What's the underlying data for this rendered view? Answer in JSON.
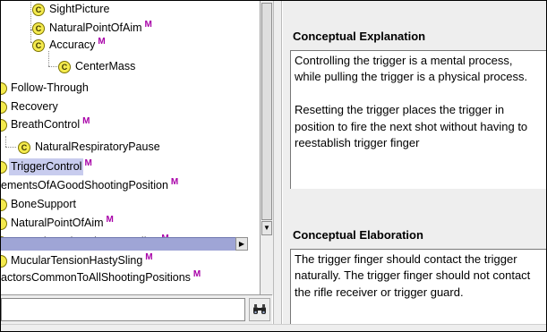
{
  "tree": {
    "items": [
      {
        "label": "SightPicture",
        "icon": "class-icon",
        "badge": ""
      },
      {
        "label": "NaturalPointOfAim",
        "icon": "class-icon",
        "badge": "M"
      },
      {
        "label": "Accuracy",
        "icon": "class-icon",
        "badge": "M"
      },
      {
        "label": "CenterMass",
        "icon": "class-icon",
        "badge": ""
      },
      {
        "label": "Follow-Through",
        "icon": "class-icon",
        "badge": ""
      },
      {
        "label": "Recovery",
        "icon": "class-icon",
        "badge": ""
      },
      {
        "label": "BreathControl",
        "icon": "class-icon",
        "badge": "M"
      },
      {
        "label": "NaturalRespiratoryPause",
        "icon": "class-icon",
        "badge": ""
      },
      {
        "label": "TriggerControl",
        "icon": "class-icon",
        "badge": "M",
        "selected": true
      },
      {
        "label": "ementsOfAGoodShootingPosition",
        "icon": "",
        "badge": "M"
      },
      {
        "label": "BoneSupport",
        "icon": "class-icon",
        "badge": ""
      },
      {
        "label": "NaturalPointOfAim",
        "icon": "class-icon",
        "badge": "M"
      },
      {
        "label": "MuscularRelaxationLoopSling",
        "icon": "class-icon",
        "badge": "M"
      },
      {
        "label": "MucularTensionHastySling",
        "icon": "class-icon",
        "badge": "M"
      },
      {
        "label": "actorsCommonToAllShootingPositions",
        "icon": "",
        "badge": "M"
      }
    ],
    "class_glyph": "C",
    "badge_color": "#a800a8",
    "selection_color": "#c8ccee"
  },
  "scrollbars": {
    "down_arrow": "▼",
    "right_arrow": "▶"
  },
  "search": {
    "value": "",
    "button_icon": "binoculars-icon"
  },
  "details": {
    "explanation_title": "Conceptual Explanation",
    "explanation_paragraphs": [
      "Controlling the trigger is a mental process, while pulling the trigger is a physical process.",
      "Resetting the trigger places the trigger in position to fire the next shot without having to reestablish trigger finger"
    ],
    "elaboration_title": "Conceptual Elaboration",
    "elaboration_paragraphs": [
      "The trigger finger should contact the trigger naturally. The trigger finger should not contact the rifle receiver or trigger guard."
    ]
  }
}
